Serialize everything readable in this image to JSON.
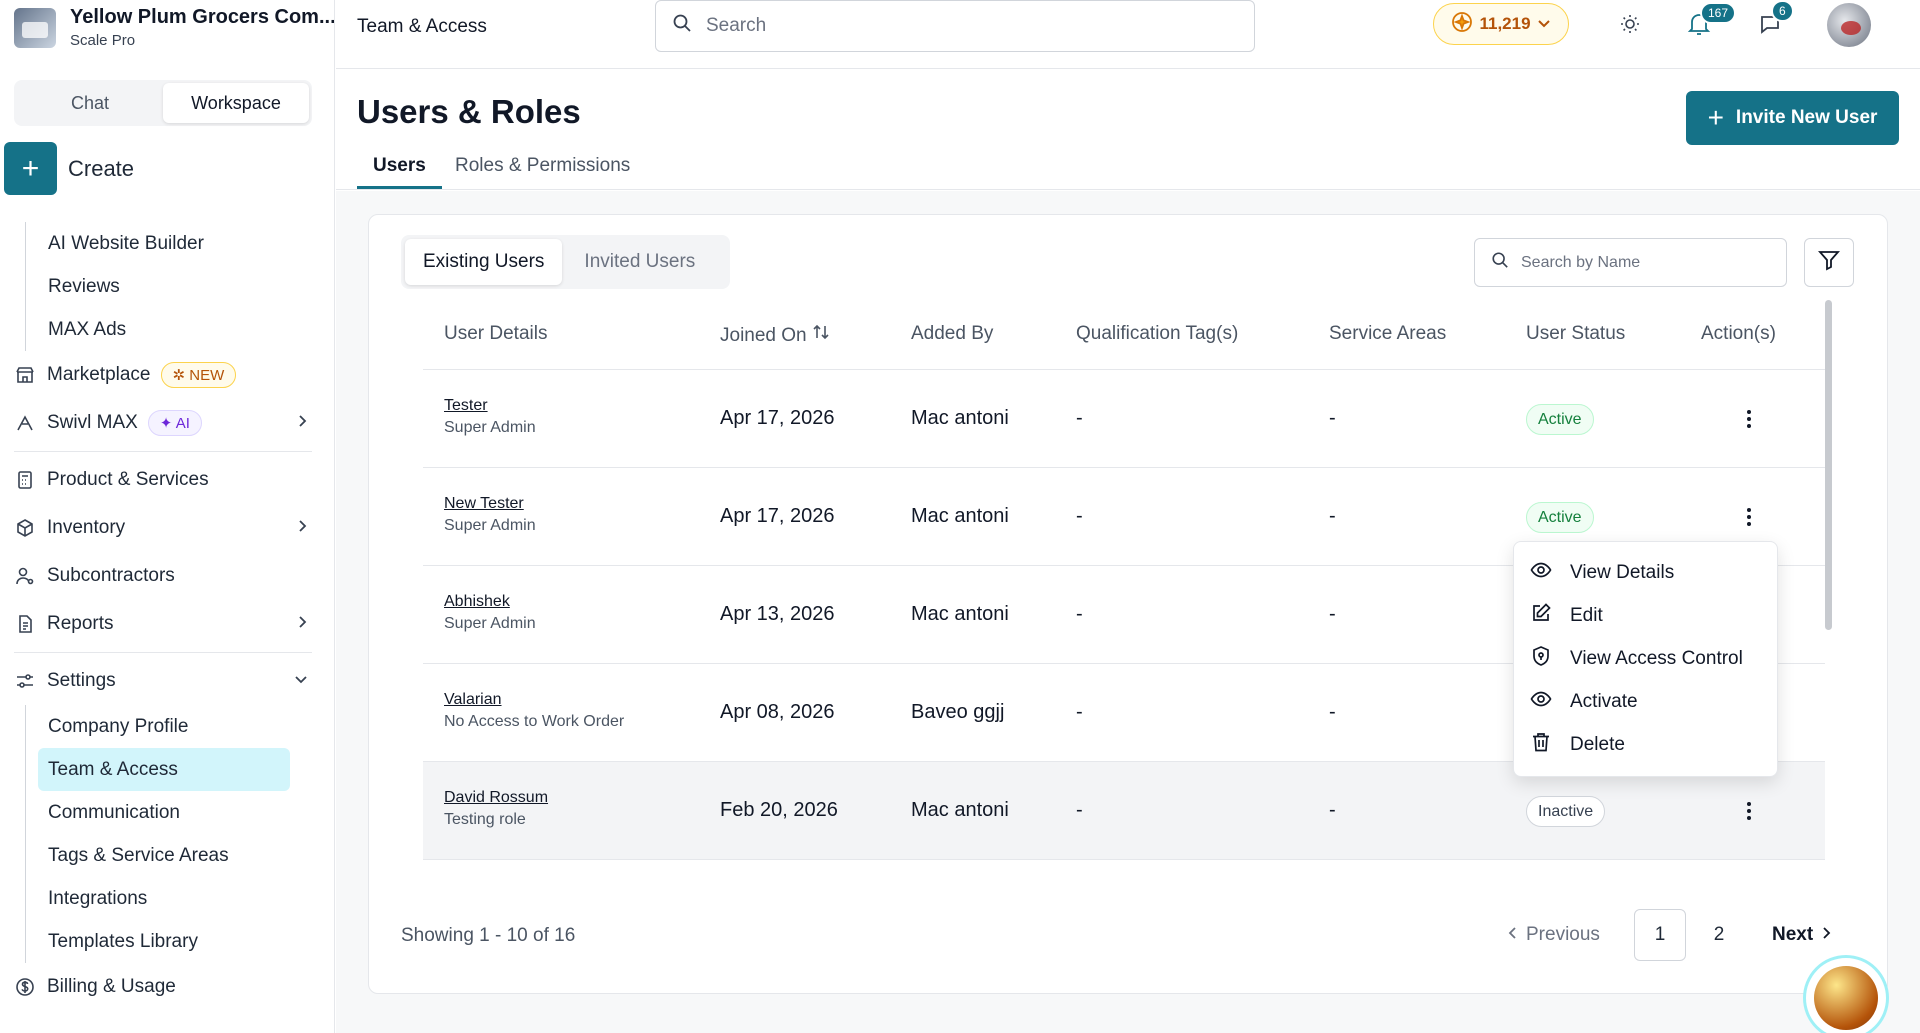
{
  "org": {
    "name": "Yellow Plum Grocers Com...",
    "plan": "Scale Pro"
  },
  "sidebar": {
    "mode_tabs": [
      "Chat",
      "Workspace"
    ],
    "create_label": "Create",
    "top_subitems": [
      "AI Website Builder",
      "Reviews",
      "MAX Ads"
    ],
    "marketplace": {
      "label": "Marketplace",
      "badge": "NEW"
    },
    "swivl": {
      "label": "Swivl MAX",
      "badge": "AI"
    },
    "items": [
      "Product & Services",
      "Inventory",
      "Subcontractors",
      "Reports",
      "Settings"
    ],
    "settings_subitems": [
      "Company Profile",
      "Team & Access",
      "Communication",
      "Tags & Service Areas",
      "Integrations",
      "Templates Library"
    ],
    "billing": "Billing & Usage"
  },
  "topbar": {
    "breadcrumb": "Team & Access",
    "search_placeholder": "Search",
    "coins": "11,219",
    "notifications": "167",
    "messages": "6"
  },
  "page": {
    "title": "Users & Roles",
    "invite_label": "Invite New User",
    "tabs": [
      "Users",
      "Roles & Permissions"
    ]
  },
  "users_panel": {
    "subtabs": [
      "Existing Users",
      "Invited Users"
    ],
    "search_placeholder": "Search by Name",
    "columns": [
      "User Details",
      "Joined On",
      "Added By",
      "Qualification Tag(s)",
      "Service Areas",
      "User Status",
      "Action(s)"
    ],
    "rows": [
      {
        "name": "Tester",
        "role": "Super Admin",
        "joined": "Apr 17, 2026",
        "added_by": "Mac antoni",
        "tags": "-",
        "areas": "-",
        "status": "Active"
      },
      {
        "name": "New Tester",
        "role": "Super Admin",
        "joined": "Apr 17, 2026",
        "added_by": "Mac antoni",
        "tags": "-",
        "areas": "-",
        "status": "Active"
      },
      {
        "name": "Abhishek",
        "role": "Super Admin",
        "joined": "Apr 13, 2026",
        "added_by": "Mac antoni",
        "tags": "-",
        "areas": "-",
        "status": ""
      },
      {
        "name": "Valarian",
        "role": "No Access to Work Order",
        "joined": "Apr 08, 2026",
        "added_by": "Baveo ggjj",
        "tags": "-",
        "areas": "-",
        "status": ""
      },
      {
        "name": "David Rossum",
        "role": "Testing role",
        "joined": "Feb 20, 2026",
        "added_by": "Mac antoni",
        "tags": "-",
        "areas": "-",
        "status": "Inactive"
      }
    ],
    "action_menu": [
      "View Details",
      "Edit",
      "View Access Control",
      "Activate",
      "Delete"
    ],
    "pagination": {
      "showing": "Showing 1 - 10 of 16",
      "previous": "Previous",
      "pages": [
        "1",
        "2"
      ],
      "next": "Next"
    }
  },
  "colors": {
    "accent": "#157288",
    "active_green": "#15803d"
  }
}
